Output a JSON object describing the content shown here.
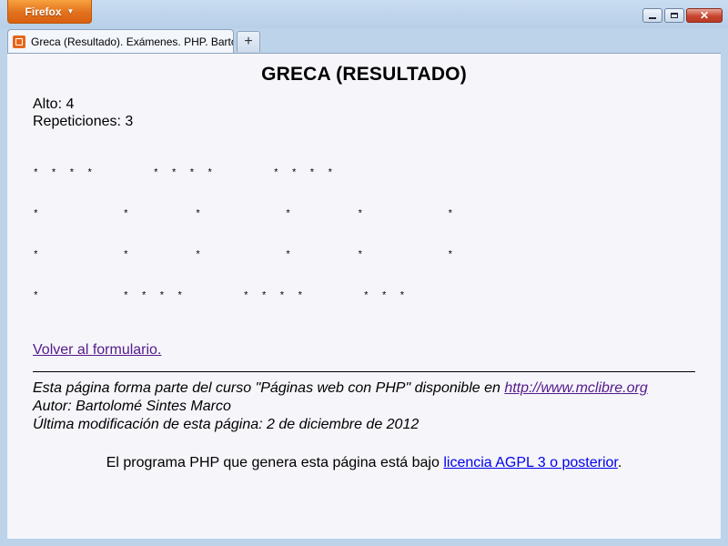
{
  "window": {
    "menu_button_label": "Firefox",
    "controls": {
      "minimize": "minimize",
      "maximize": "maximize",
      "close": "close"
    }
  },
  "tab": {
    "title": "Greca (Resultado). Exámenes. PHP. Barto...",
    "new_tab_label": "+"
  },
  "page": {
    "heading": "GRECA (RESULTADO)",
    "alto_label": "Alto: 4",
    "repeticiones_label": "Repeticiones: 3",
    "greca_lines": [
      "*  *  *  *          *  *  *  *          *  *  *  *",
      "*              *           *              *           *              *",
      "*              *           *              *           *              *",
      "*              *  *  *  *          *  *  *  *          *  *  *"
    ],
    "back_link": "Volver al formulario.",
    "footer_line1_prefix": "Esta página forma parte del curso \"Páginas web con PHP\" disponible en ",
    "footer_line1_link": "http://www.mclibre.org",
    "footer_author": "Autor: Bartolomé Sintes Marco",
    "footer_modified": "Última modificación de esta página: 2 de diciembre de 2012",
    "license_prefix": "El programa PHP que genera esta página está bajo ",
    "license_link": "licencia AGPL 3 o posterior",
    "license_suffix": "."
  }
}
